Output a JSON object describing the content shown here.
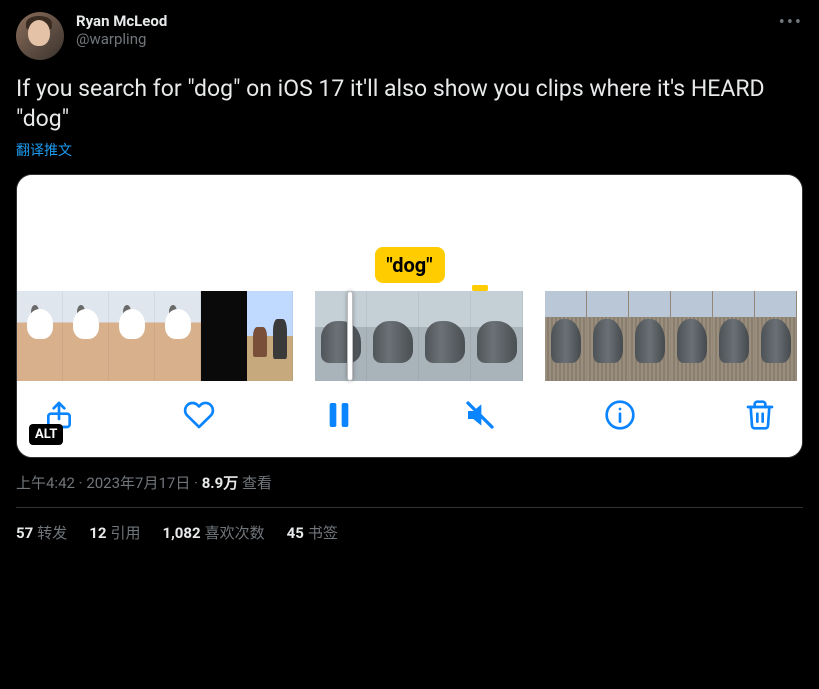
{
  "author": {
    "display_name": "Ryan McLeod",
    "handle": "@warpling"
  },
  "body_text": "If you search for \"dog\" on iOS 17 it'll also show you clips where it's HEARD \"dog\"",
  "translate_label": "翻译推文",
  "media": {
    "caption_bubble": "\"dog\"",
    "alt_badge": "ALT"
  },
  "meta": {
    "time": "上午4:42",
    "separator": " · ",
    "date": "2023年7月17日",
    "views_count": "8.9万",
    "views_label": " 查看"
  },
  "stats": {
    "retweets": {
      "count": "57",
      "label": "转发"
    },
    "quotes": {
      "count": "12",
      "label": "引用"
    },
    "likes": {
      "count": "1,082",
      "label": "喜欢次数"
    },
    "bookmarks": {
      "count": "45",
      "label": "书签"
    }
  }
}
